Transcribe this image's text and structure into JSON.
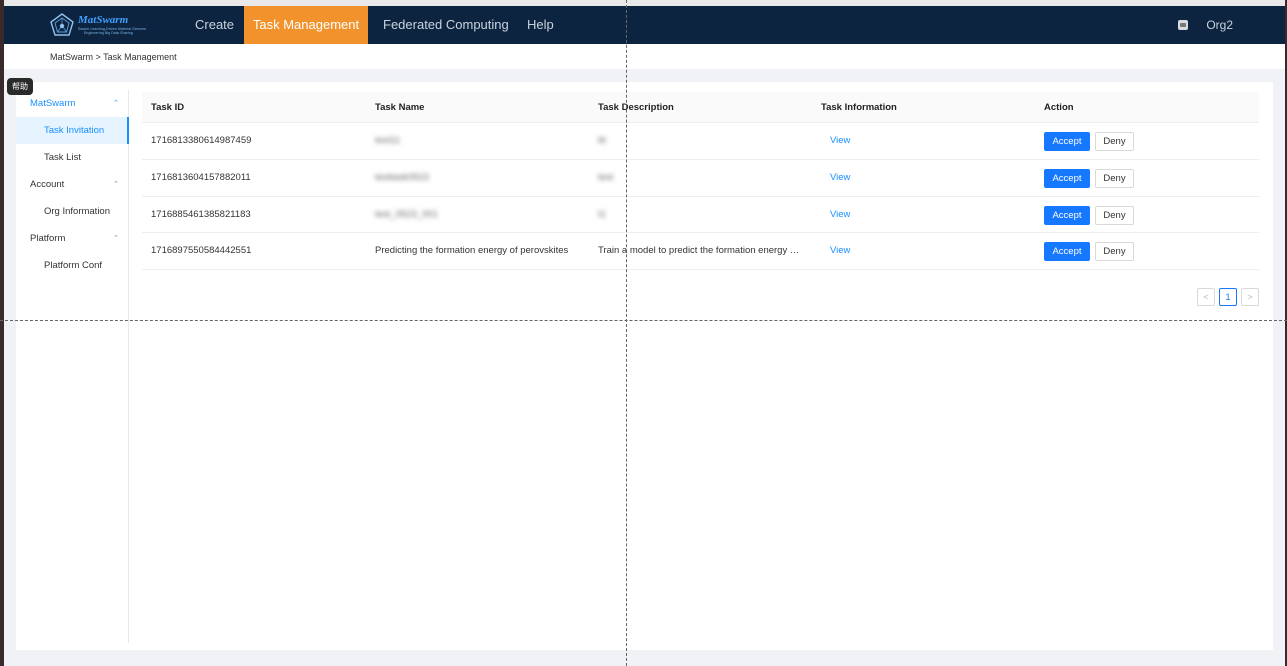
{
  "brand": {
    "title": "MatSwarm",
    "subtitle_line1": "Swarm Learning-Driven Material Genome",
    "subtitle_line2": "Engineering Big Data Sharing"
  },
  "nav": {
    "items": [
      {
        "label": "Create"
      },
      {
        "label": "Task Management"
      },
      {
        "label": "Federated Computing"
      },
      {
        "label": "Help"
      }
    ],
    "org_label": "Org2"
  },
  "breadcrumb": "MatSwarm > Task Management",
  "help_tip": "帮助",
  "sidebar": {
    "groups": [
      {
        "label": "MatSwarm",
        "items": [
          {
            "label": "Task Invitation"
          },
          {
            "label": "Task List"
          }
        ]
      },
      {
        "label": "Account",
        "items": [
          {
            "label": "Org Information"
          }
        ]
      },
      {
        "label": "Platform",
        "items": [
          {
            "label": "Platform Conf"
          }
        ]
      }
    ]
  },
  "table": {
    "headers": [
      "Task ID",
      "Task Name",
      "Task Description",
      "Task Information",
      "Action"
    ],
    "rows": [
      {
        "id": "1716813380614987459",
        "name": "test11",
        "desc": "ttt",
        "info": "View",
        "accept": "Accept",
        "deny": "Deny"
      },
      {
        "id": "1716813604157882011",
        "name": "testtask0523",
        "desc": "test",
        "info": "View",
        "accept": "Accept",
        "deny": "Deny"
      },
      {
        "id": "1716885461385821183",
        "name": "test_0523_001",
        "desc": "t1",
        "info": "View",
        "accept": "Accept",
        "deny": "Deny"
      },
      {
        "id": "1716897550584442551",
        "name": "Predicting the formation energy of perovskites",
        "desc": "Train a model to predict the formation energy …",
        "info": "View",
        "accept": "Accept",
        "deny": "Deny"
      }
    ]
  },
  "pagination": {
    "prev": "<",
    "current": "1",
    "next": ">"
  }
}
